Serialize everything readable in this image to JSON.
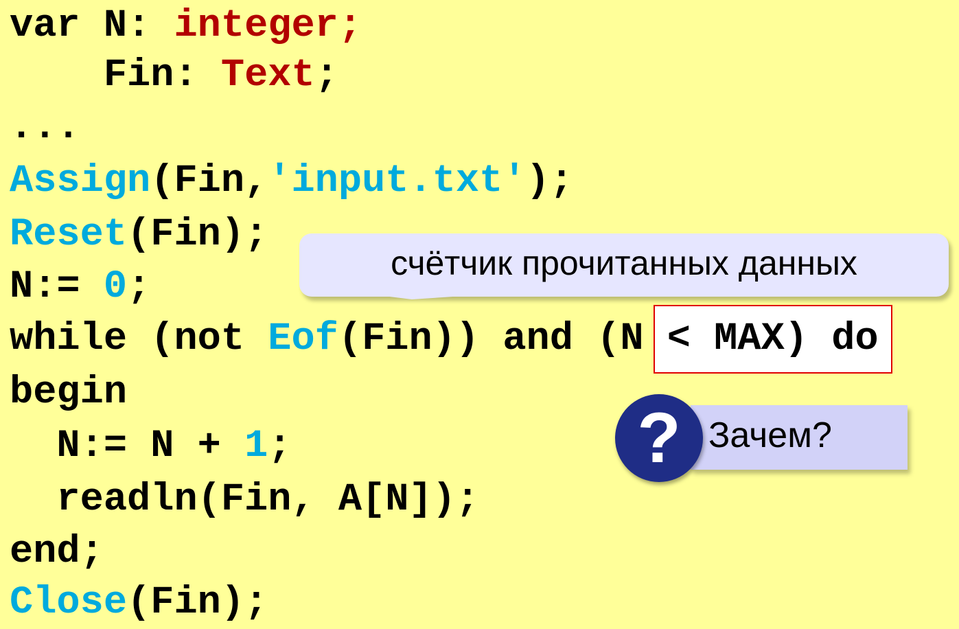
{
  "code": {
    "line1": {
      "a": "var N: ",
      "b": "integer;"
    },
    "line2": {
      "a": "    Fin: ",
      "b": "Text",
      "c": ";"
    },
    "line3": "...",
    "line4": {
      "a": "Assign",
      "b": "(Fin,",
      "c": "'input.txt'",
      "d": ");"
    },
    "line5": {
      "a": "Reset",
      "b": "(Fin);"
    },
    "line6": {
      "a": "N:= ",
      "b": "0",
      "c": ";"
    },
    "line7": {
      "a": "while (not ",
      "b": "Eof",
      "c": "(Fin)) and ",
      "d": "(N < MAX)",
      "e": " do"
    },
    "line8": "begin",
    "line9": {
      "a": "  N:= N + ",
      "b": "1",
      "c": ";"
    },
    "line10": "  readln(Fin, A[N]);",
    "line11": "end;",
    "line12": {
      "a": "Close",
      "b": "(Fin);"
    }
  },
  "callouts": {
    "counter_note": "счётчик прочитанных данных",
    "question_mark": "?",
    "question": "Зачем?"
  },
  "colors": {
    "background": "#ffff99",
    "keyword_red": "#b20000",
    "function_blue": "#00aadd",
    "highlight_border": "#e00000",
    "question_icon": "#1f2d86"
  }
}
